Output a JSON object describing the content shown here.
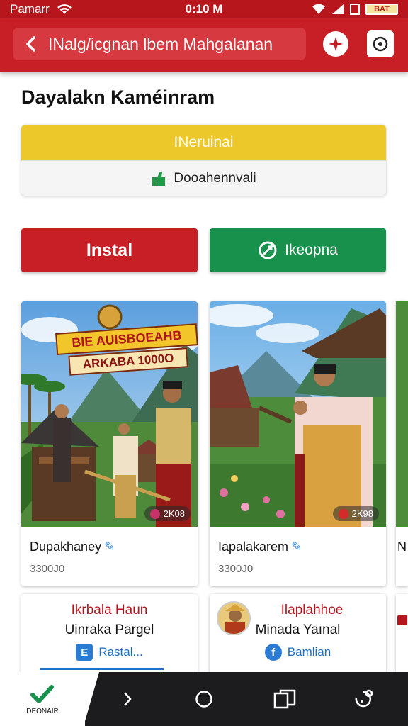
{
  "status_bar": {
    "carrier": "Pamarr",
    "time": "0:10 M",
    "battery": "BAT"
  },
  "app_bar": {
    "search_text": "INalg/icgnan lbem Mahgalanan"
  },
  "page": {
    "title": "Dayalakn Kaméinram"
  },
  "status_card": {
    "top_label": "INeruinai",
    "bottom_label": "Dooahennvali"
  },
  "buttons": {
    "install": "Instal",
    "share": "Ikeopna"
  },
  "cards": [
    {
      "overlay_line1": "BIE AUISBOEAHB",
      "overlay_line2": "ARKABA 1000O",
      "badge": "2K08",
      "name": "Dupakhaney",
      "sub": "3300J0"
    },
    {
      "badge": "2K98",
      "name": "Iapalakarem",
      "sub": "3300J0"
    }
  ],
  "promos": [
    {
      "title": "Ikrbala Haun",
      "subtitle": "Uinraka Pargel",
      "link": "Rastal...",
      "link_icon": "E"
    },
    {
      "title": "Ilaplahhoe",
      "subtitle": "Minada Yaınal",
      "link": "Bamlian",
      "link_icon": "f"
    }
  ],
  "peek_letter": "N",
  "nav": {
    "home_label": "DEONAIR"
  },
  "colors": {
    "primary_red": "#c81e25",
    "yellow": "#ecc82a",
    "green": "#17914c",
    "blue": "#2a7bd4"
  }
}
